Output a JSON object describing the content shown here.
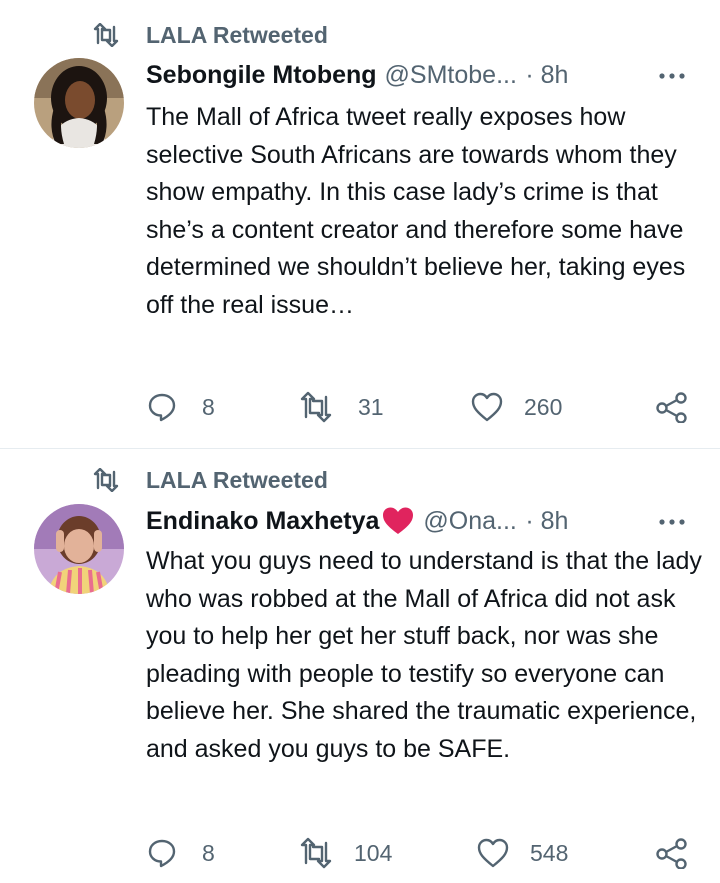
{
  "colors": {
    "text": "#0f1419",
    "secondary": "#536471",
    "divider": "#e6ecf0",
    "heart": "#e0245e"
  },
  "tweets": [
    {
      "retweeted_by": "LALA Retweeted",
      "author_name": "Sebongile Mtobeng",
      "author_handle": "@SMtobe...",
      "time": "· 8h",
      "text": "The Mall of Africa tweet really exposes how selective South Africans are towards whom they show empathy. In this case lady’s crime is that she’s a content creator and therefore some have determined we shouldn’t believe her, taking eyes off the real issue…",
      "replies": "8",
      "retweets": "31",
      "likes": "260"
    },
    {
      "retweeted_by": "LALA Retweeted",
      "author_name": "Endinako Maxhetya",
      "author_handle": "@Ona...",
      "time": "· 8h",
      "text": "What you guys need to understand is that the lady who was robbed at the Mall of Africa did not ask you to help her get her stuff back, nor was she pleading with people to testify so everyone can believe her. She shared the traumatic experience, and asked you guys to be SAFE.",
      "replies": "8",
      "retweets": "104",
      "likes": "548"
    }
  ]
}
